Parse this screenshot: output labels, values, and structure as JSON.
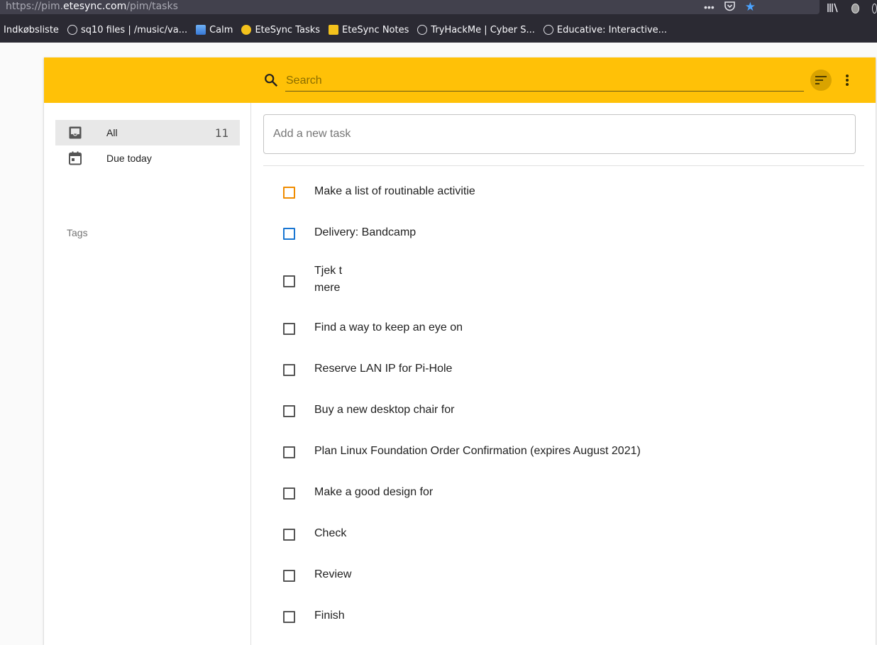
{
  "browser": {
    "url_prefix": "https://pim.",
    "url_host": "etesync.com",
    "url_path": "/pim/tasks",
    "bookmarks": [
      {
        "label": "Indkøbsliste",
        "icon": "none"
      },
      {
        "label": "sq10 files | /music/va...",
        "icon": "globe-icon"
      },
      {
        "label": "Calm",
        "icon": "calm-icon"
      },
      {
        "label": "EteSync Tasks",
        "icon": "etesync-icon"
      },
      {
        "label": "EteSync Notes",
        "icon": "notes-icon"
      },
      {
        "label": "TryHackMe | Cyber S...",
        "icon": "globe-icon"
      },
      {
        "label": "Educative: Interactive...",
        "icon": "globe-icon"
      }
    ]
  },
  "colors": {
    "accent": "#ffc107",
    "priority_high": "#f08c00",
    "priority_medium": "#1976d2"
  },
  "appbar": {
    "search_placeholder": "Search"
  },
  "sidebar": {
    "all_label": "All",
    "all_count": "11",
    "due_today_label": "Due today",
    "tags_heading": "Tags"
  },
  "main": {
    "add_task_placeholder": "Add a new task",
    "tasks": [
      {
        "title": "Make a list of routinable activitie",
        "priority": "high"
      },
      {
        "title": "Delivery: Bandcamp",
        "priority": "medium"
      },
      {
        "title": "Tjek t mere",
        "priority": "none"
      },
      {
        "title": "Find a way to keep an eye on",
        "priority": "none"
      },
      {
        "title": "Reserve LAN IP for Pi-Hole",
        "priority": "none"
      },
      {
        "title": "Buy a new desktop chair for",
        "priority": "none"
      },
      {
        "title": "Plan Linux Foundation Order Confirmation (expires August 2021)",
        "priority": "none"
      },
      {
        "title": "Make a good design for",
        "priority": "none"
      },
      {
        "title": "Check",
        "priority": "none"
      },
      {
        "title": "Review",
        "priority": "none"
      },
      {
        "title": "Finish",
        "priority": "none"
      }
    ]
  }
}
